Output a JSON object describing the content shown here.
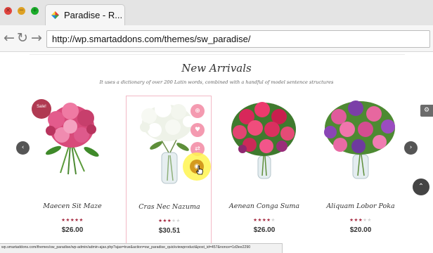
{
  "browser": {
    "tab_title": "Paradise - R...",
    "url": "http://wp.smartaddons.com/themes/sw_paradise/",
    "icons": {
      "close": "close-icon",
      "minimize": "minimize-icon",
      "maximize": "maximize-icon",
      "back": "back-arrow-icon",
      "reload": "reload-icon",
      "forward": "forward-arrow-icon"
    },
    "window_button_colors": {
      "close": "#e0443e",
      "minimize": "#dea123",
      "maximize": "#1aab29"
    }
  },
  "section": {
    "title": "New Arrivals",
    "subtitle": "It uses a dictionary of over 200 Latin words, combined with a handful of model sentence structures"
  },
  "products": [
    {
      "name": "Maecen Sit Maze",
      "price": "$26.00",
      "rating": 5,
      "badge": "Sale!",
      "image": "pink-lily-bouquet"
    },
    {
      "name": "Cras Nec Nazuma",
      "price": "$30.51",
      "rating": 3,
      "image": "white-blossom-vase"
    },
    {
      "name": "Aenean Conga Suma",
      "price": "$26.00",
      "rating": 4,
      "image": "pink-rose-bouquet"
    },
    {
      "name": "Aliquam Lobor Poka",
      "price": "$20.00",
      "rating": 3,
      "image": "purple-pink-bouquet"
    }
  ],
  "hover_actions": [
    "cart-icon",
    "heart-icon",
    "compare-icon",
    "quickview-icon"
  ],
  "controls": {
    "prev_icon": "chevron-left-icon",
    "next_icon": "chevron-right-icon",
    "side_tool_icon": "settings-icon",
    "back_to_top_icon": "chevron-up-icon"
  },
  "colors": {
    "accent_pink": "#f49ab0",
    "star": "#a3263d",
    "star_empty": "#d3d3d3",
    "sale_badge": "#b03a52"
  },
  "status_bar": "wp.smartaddons.com/themes/sw_paradise/wp-admin/admin-ajax.php?ajax=true&action=sw_paradise_quickviewproduct&post_id=457&nonce=1d3ee2290"
}
